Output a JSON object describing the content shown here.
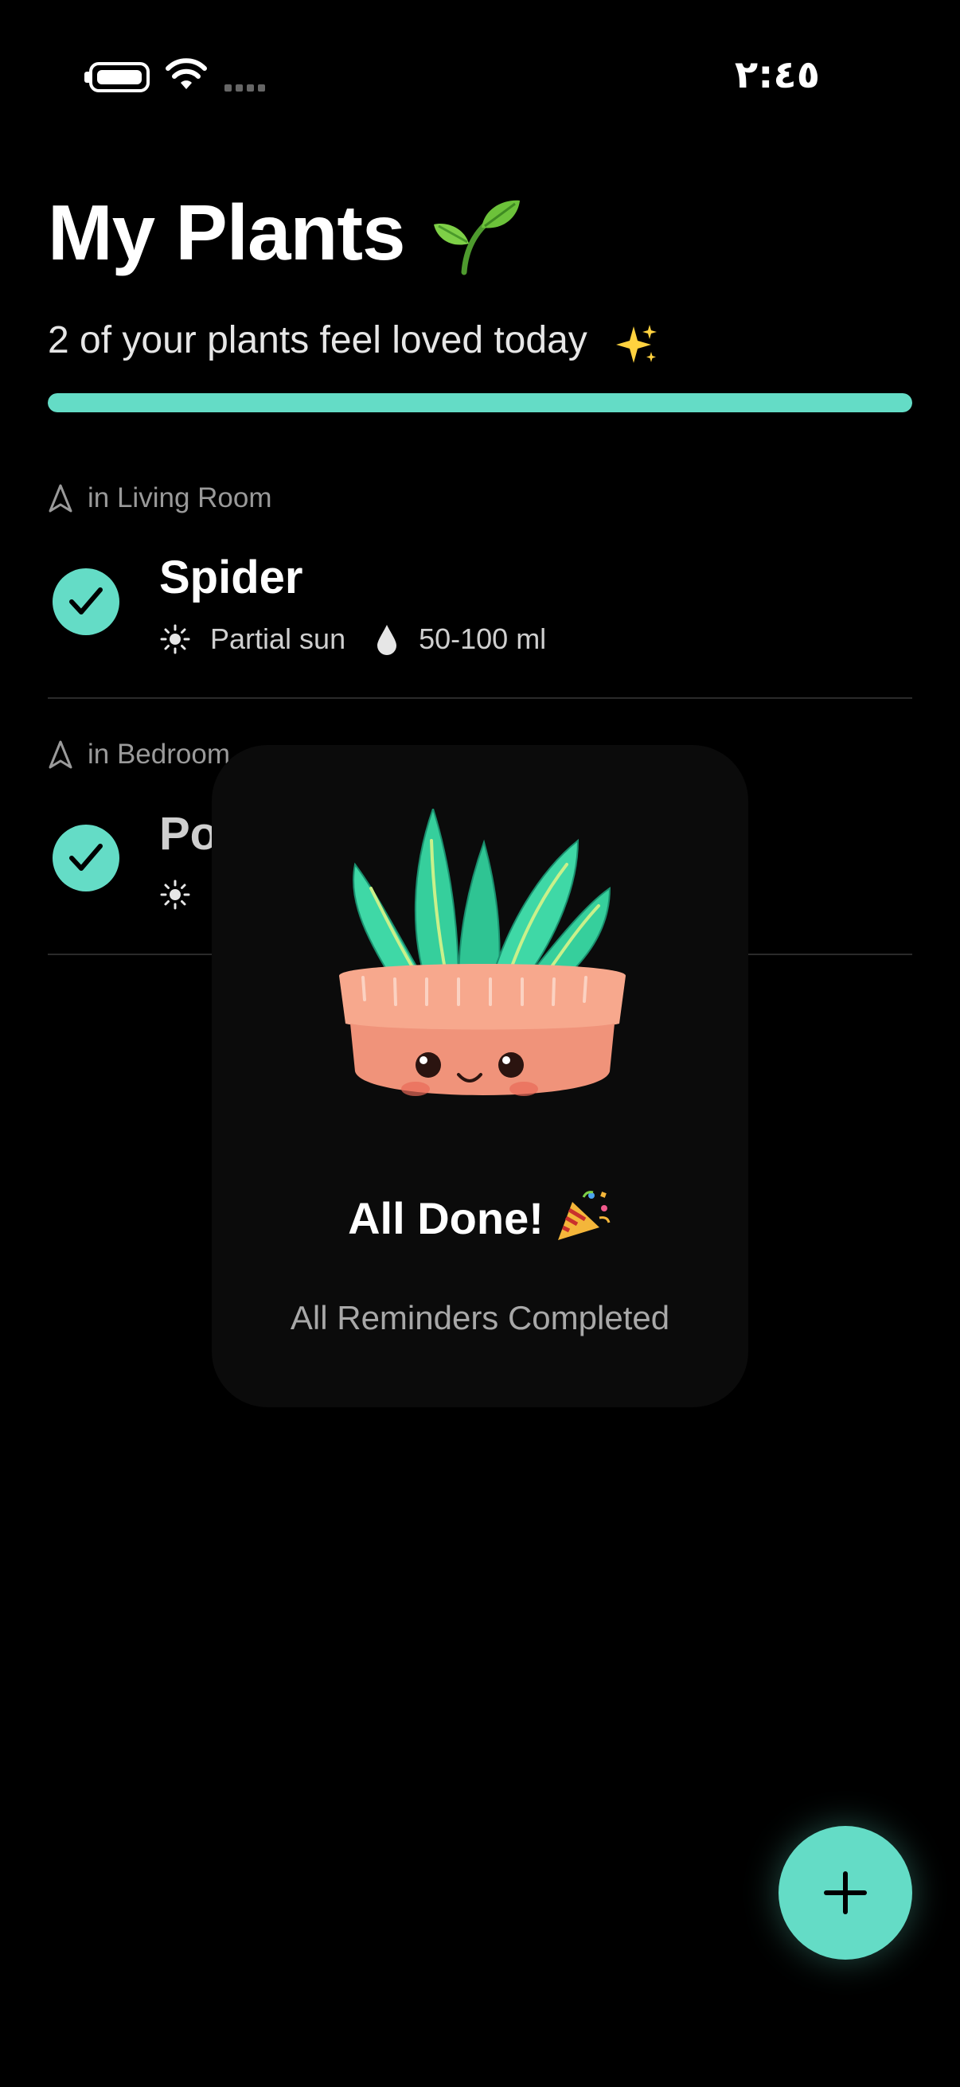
{
  "status_bar": {
    "time": "٢:٤٥",
    "battery_icon": "battery-full-icon",
    "wifi_icon": "wifi-icon",
    "signal_icon": "signal-dots-icon"
  },
  "header": {
    "title": "My Plants",
    "title_icon": "seedling-icon",
    "subtitle": "2 of your plants feel loved today",
    "subtitle_icon": "sparkles-icon",
    "progress": 1.0
  },
  "plants": [
    {
      "location": "in Living Room",
      "name": "Spider",
      "light": "Partial sun",
      "water": "50-100 ml",
      "done": true
    },
    {
      "location": "in Bedroom",
      "name": "Po",
      "done": true
    }
  ],
  "completion": {
    "title": "All Done!",
    "title_icon": "party-popper-icon",
    "subtitle": "All Reminders Completed",
    "image": "smiling-potted-aloe-illustration"
  },
  "fab": {
    "icon": "plus-icon"
  },
  "colors": {
    "accent": "#64dcc6",
    "background": "#000000",
    "card": "#0b0b0b",
    "pot": "#f0937a"
  }
}
